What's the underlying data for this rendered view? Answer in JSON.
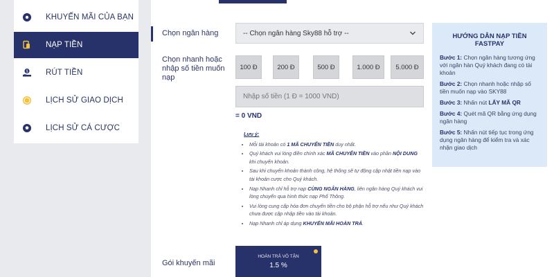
{
  "sidebar": {
    "items": [
      {
        "label": "Khuyến mãi của bạn",
        "icon": "gear-badge-icon"
      },
      {
        "label": "Nạp tiền",
        "icon": "wallet-icon",
        "active": true
      },
      {
        "label": "Rút tiền",
        "icon": "hand-coin-icon"
      },
      {
        "label": "Lịch sử giao dịch",
        "icon": "coin-icon"
      },
      {
        "label": "Lịch sử cá cược",
        "icon": "soccer-ball-icon"
      }
    ]
  },
  "form": {
    "bank_label": "Chọn ngân hàng",
    "bank_selected": "-- Chọn ngân hàng Sky88 hỗ trợ --",
    "quick_label_1": "Chọn nhanh hoặc",
    "quick_label_2": "nhập số tiền muốn",
    "quick_label_3": "nạp",
    "amounts": [
      "100 Đ",
      "200 Đ",
      "500 Đ",
      "1.000 Đ",
      "5.000 Đ"
    ],
    "amount_placeholder": "Nhập số tiền (1 Đ = 1000 VND)",
    "converted": "= 0 VND",
    "promo_label": "Gói khuyến mãi"
  },
  "notes": {
    "title": "Lưu ý:",
    "items": [
      {
        "pre": "Mỗi tài khoản có ",
        "bold": "1 MÃ CHUYỂN TIỀN",
        "post": " duy nhất."
      },
      {
        "pre": "Quý khách vui lòng điền chính xác ",
        "bold": "MÃ CHUYỂN TIỀN",
        "post": " vào phần ",
        "bold2": "NỘI DUNG",
        "post2": " khi chuyển khoản."
      },
      {
        "pre": "Sau khi chuyển khoản thành công, hệ thống sẽ tự động cập nhật tiền nạp vào tài khoản cược cho Quý khách."
      },
      {
        "pre": "Nạp Nhanh chỉ hỗ trợ nạp ",
        "bold": "CÙNG NGÂN HÀNG",
        "post": ", liên ngân hàng Quý khách vui lòng chuyển qua hình thức nạp Phổ Thông."
      },
      {
        "pre": "Vui lòng cung cấp hóa đơn chuyển tiền cho bộ phận hỗ trợ nếu như Quý khách chưa được cập nhập tiền vào tài khoản."
      },
      {
        "pre": "Nạp Nhanh chỉ áp dụng ",
        "bold": "KHUYẾN MÃI HOÀN TRẢ",
        "post": "."
      }
    ]
  },
  "promo": {
    "name": "HOÀN TRẢ VÔ TẬN",
    "rate": "1.5 %"
  },
  "guide": {
    "title": "Hướng dẫn nạp tiền Fastpay",
    "steps": [
      {
        "label": "Bước 1:",
        "text": " Chọn ngân hàng tương ứng với ngân hàn Quý khách đang có tài khoản"
      },
      {
        "label": "Bước 2:",
        "text": " Chọn nhanh hoặc nhập số tiền muốn nạp vào SKY88"
      },
      {
        "label": "Bước 3:",
        "text": " Nhấn nút ",
        "bold": "LẤY MÃ QR"
      },
      {
        "label": "Bước 4:",
        "text": " Quét mã QR bằng ứng dụng ngân hàng"
      },
      {
        "label": "Bước 5:",
        "text": " Nhấn nút tiếp tục trong ứng dụng ngân hàng để kiểm tra và xác nhận giao dịch"
      }
    ]
  },
  "colors": {
    "brand": "#27326a",
    "guide_bg": "#dce9f8",
    "accent_dot": "#f3c23c"
  }
}
